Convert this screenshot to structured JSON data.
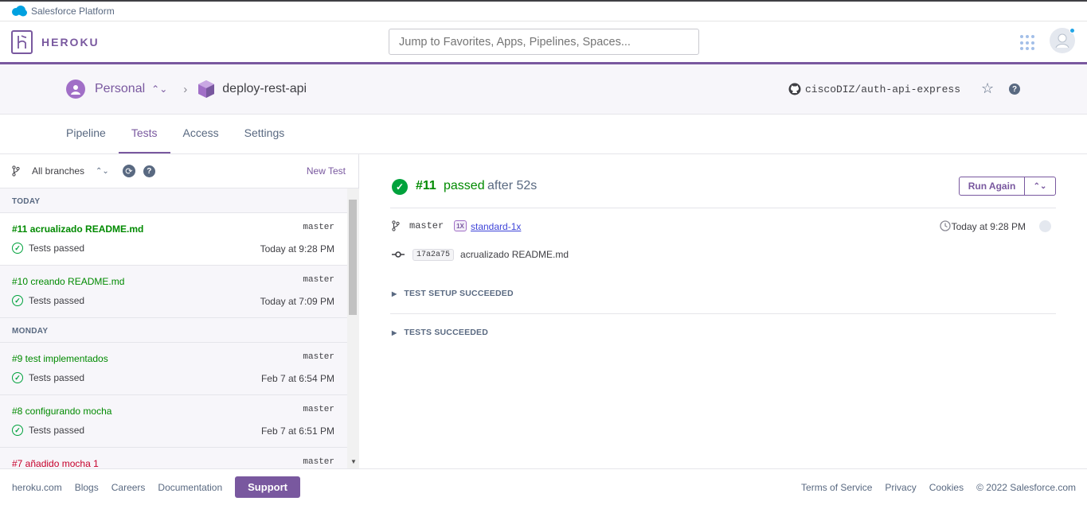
{
  "sf": {
    "label": "Salesforce Platform"
  },
  "header": {
    "brand": "HEROKU",
    "search_placeholder": "Jump to Favorites, Apps, Pipelines, Spaces..."
  },
  "appbar": {
    "team": "Personal",
    "app": "deploy-rest-api",
    "repo": "ciscoDIZ/auth-api-express"
  },
  "tabs": [
    {
      "label": "Pipeline"
    },
    {
      "label": "Tests"
    },
    {
      "label": "Access"
    },
    {
      "label": "Settings"
    }
  ],
  "left": {
    "branch_filter": "All branches",
    "new_test": "New Test",
    "groups": [
      {
        "label": "TODAY",
        "items": [
          {
            "title": "#11 acrualizado README.md",
            "branch": "master",
            "status": "Tests passed",
            "time": "Today at 9:28 PM"
          },
          {
            "title": "#10 creando README.md",
            "branch": "master",
            "status": "Tests passed",
            "time": "Today at 7:09 PM"
          }
        ]
      },
      {
        "label": "MONDAY",
        "items": [
          {
            "title": "#9 test implementados",
            "branch": "master",
            "status": "Tests passed",
            "time": "Feb 7 at 6:54 PM"
          },
          {
            "title": "#8 configurando mocha",
            "branch": "master",
            "status": "Tests passed",
            "time": "Feb 7 at 6:51 PM"
          },
          {
            "title": "#7 añadido mocha 1",
            "branch": "master"
          }
        ]
      }
    ]
  },
  "detail": {
    "number": "#11",
    "passed": "passed",
    "after": "after 52s",
    "run_again": "Run Again",
    "branch": "master",
    "dyno_badge": "1X",
    "dyno": "standard-1x",
    "time": "Today at 9:28 PM",
    "sha": "17a2a75",
    "message": "acrualizado README.md",
    "sections": [
      "TEST SETUP SUCCEEDED",
      "TESTS SUCCEEDED"
    ]
  },
  "footer": {
    "links": [
      "heroku.com",
      "Blogs",
      "Careers",
      "Documentation"
    ],
    "support": "Support",
    "right": [
      "Terms of Service",
      "Privacy",
      "Cookies",
      "© 2022 Salesforce.com"
    ]
  },
  "colors": {
    "brand": "#79589f",
    "pass": "#008a00",
    "fail": "#c6002b"
  }
}
